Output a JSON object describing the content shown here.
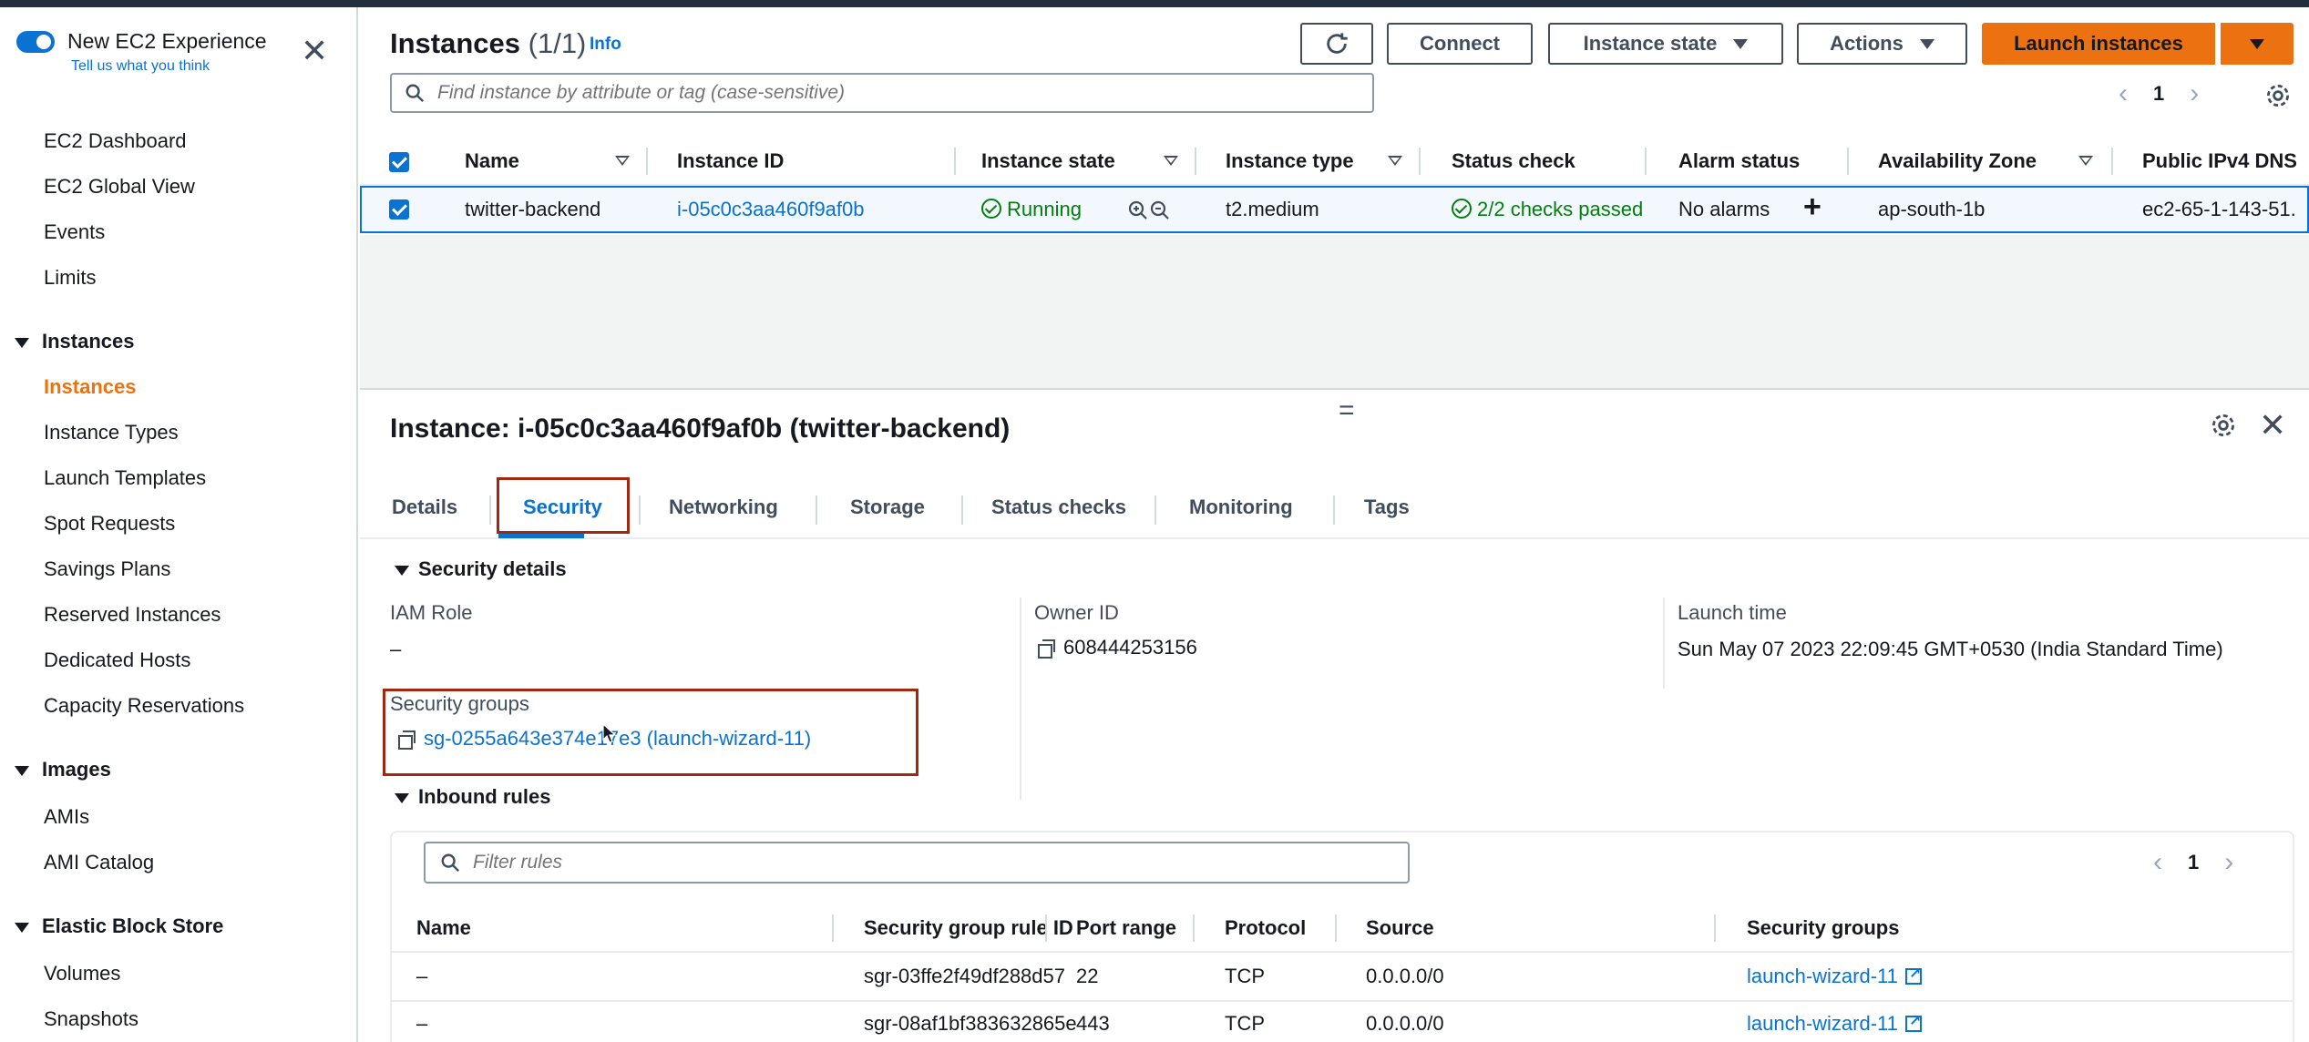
{
  "sidebar": {
    "toggle_label": "New EC2 Experience",
    "toggle_sub": "Tell us what you think",
    "close": "✕",
    "items_top": [
      "EC2 Dashboard",
      "EC2 Global View",
      "Events",
      "Limits"
    ],
    "sections": [
      {
        "title": "Instances",
        "items": [
          "Instances",
          "Instance Types",
          "Launch Templates",
          "Spot Requests",
          "Savings Plans",
          "Reserved Instances",
          "Dedicated Hosts",
          "Capacity Reservations"
        ]
      },
      {
        "title": "Images",
        "items": [
          "AMIs",
          "AMI Catalog"
        ]
      },
      {
        "title": "Elastic Block Store",
        "items": [
          "Volumes",
          "Snapshots"
        ]
      }
    ],
    "active_item": "Instances"
  },
  "header": {
    "title": "Instances",
    "count": "(1/1)",
    "info": "Info",
    "refresh_icon": "refresh-icon",
    "connect": "Connect",
    "instance_state": "Instance state",
    "actions": "Actions",
    "launch": "Launch instances",
    "search_placeholder": "Find instance by attribute or tag (case-sensitive)",
    "page": "1"
  },
  "table": {
    "columns": [
      "Name",
      "Instance ID",
      "Instance state",
      "Instance type",
      "Status check",
      "Alarm status",
      "Availability Zone",
      "Public IPv4 DNS"
    ],
    "row": {
      "name": "twitter-backend",
      "instance_id": "i-05c0c3aa460f9af0b",
      "state": "Running",
      "type": "t2.medium",
      "status_check": "2/2 checks passed",
      "alarm": "No alarms",
      "az": "ap-south-1b",
      "dns": "ec2-65-1-143-51."
    }
  },
  "details": {
    "drag_handle": "=",
    "title": "Instance: i-05c0c3aa460f9af0b (twitter-backend)",
    "tabs": [
      "Details",
      "Security",
      "Networking",
      "Storage",
      "Status checks",
      "Monitoring",
      "Tags"
    ],
    "selected_tab": "Security",
    "security_details": "Security details",
    "iam_role_label": "IAM Role",
    "iam_role_value": "–",
    "owner_label": "Owner ID",
    "owner_value": "608444253156",
    "launch_label": "Launch time",
    "launch_value": "Sun May 07 2023 22:09:45 GMT+0530 (India Standard Time)",
    "sg_label": "Security groups",
    "sg_value": "sg-0255a643e374e17e3 (launch-wizard-11)"
  },
  "inbound": {
    "title": "Inbound rules",
    "filter_placeholder": "Filter rules",
    "page": "1",
    "columns": [
      "Name",
      "Security group rule ID",
      "Port range",
      "Protocol",
      "Source",
      "Security groups"
    ],
    "rows": [
      {
        "name": "–",
        "rule_id": "sgr-03ffe2f49df288d57",
        "port": "22",
        "protocol": "TCP",
        "source": "0.0.0.0/0",
        "sg": "launch-wizard-11"
      },
      {
        "name": "–",
        "rule_id": "sgr-08af1bf383632865e",
        "port": "443",
        "protocol": "TCP",
        "source": "0.0.0.0/0",
        "sg": "launch-wizard-11"
      }
    ]
  },
  "colors": {
    "accent": "#0972d3",
    "orange": "#ec7211",
    "success": "#037f0c",
    "highlight": "#a1270e"
  }
}
